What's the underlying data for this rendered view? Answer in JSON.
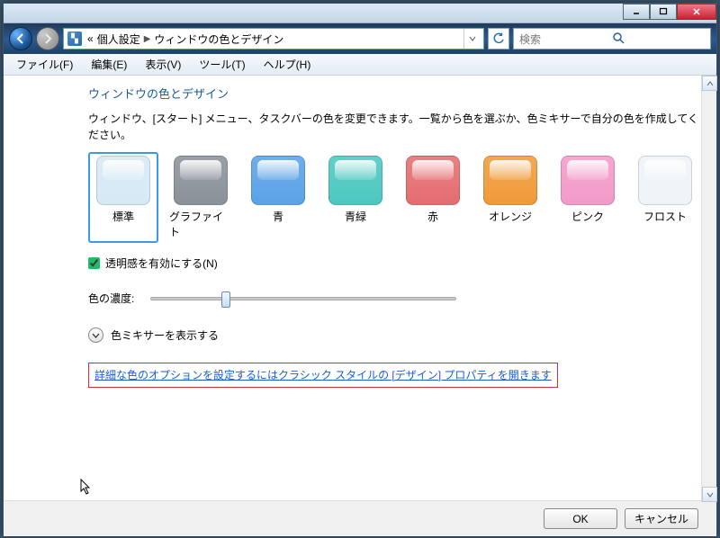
{
  "titlebar": {
    "minimize": "_",
    "maximize": "□",
    "close": "×"
  },
  "nav": {
    "back": "←",
    "forward": "→"
  },
  "breadcrumb": {
    "prefix": "«",
    "items": [
      "個人設定",
      "ウィンドウの色とデザイン"
    ]
  },
  "search": {
    "placeholder": "検索"
  },
  "menu": {
    "file": "ファイル(F)",
    "edit": "編集(E)",
    "view": "表示(V)",
    "tools": "ツール(T)",
    "help": "ヘルプ(H)"
  },
  "page": {
    "title": "ウィンドウの色とデザイン",
    "desc": "ウィンドウ、[スタート] メニュー、タスクバーの色を変更できます。一覧から色を選ぶか、色ミキサーで自分の色を作成してください。"
  },
  "swatches": [
    {
      "label": "標準",
      "color": "#d6e9f5",
      "selected": true
    },
    {
      "label": "グラファイト",
      "color": "#8a9199",
      "selected": false
    },
    {
      "label": "青",
      "color": "#5aa2e6",
      "selected": false
    },
    {
      "label": "青緑",
      "color": "#4dc7c0",
      "selected": false
    },
    {
      "label": "赤",
      "color": "#e46d70",
      "selected": false
    },
    {
      "label": "オレンジ",
      "color": "#ef9a3a",
      "selected": false
    },
    {
      "label": "ピンク",
      "color": "#f29ac9",
      "selected": false
    },
    {
      "label": "フロスト",
      "color": "#eef3f7",
      "selected": false
    }
  ],
  "transparency": {
    "label": "透明感を有効にする(N)",
    "checked": true
  },
  "intensity": {
    "label": "色の濃度:",
    "value": 25
  },
  "mixer": {
    "label": "色ミキサーを表示する"
  },
  "link": {
    "text": "詳細な色のオプションを設定するにはクラシック スタイルの [デザイン] プロパティを開きます"
  },
  "footer": {
    "ok": "OK",
    "cancel": "キャンセル"
  }
}
